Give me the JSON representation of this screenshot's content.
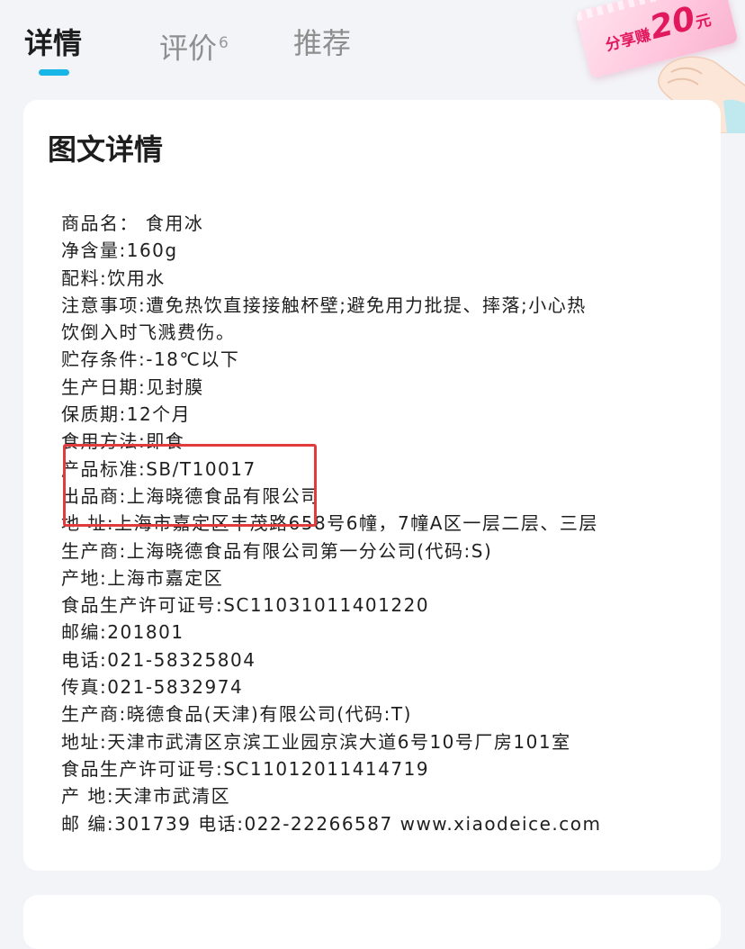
{
  "tabs": {
    "details": "详情",
    "reviews": "评价",
    "reviews_count": "6",
    "recommend": "推荐",
    "active": "details",
    "indicator_color": "#18b6e6"
  },
  "promo": {
    "prefix": "分享赚",
    "amount": "20",
    "unit": "元",
    "color": "#e2185c"
  },
  "section": {
    "title": "图文详情"
  },
  "details": [
    "商品名： 食用冰",
    "净含量:160g",
    "配料:饮用水",
    "注意事项:遭免热饮直接接触杯壁;避免用力批提、摔落;小心热",
    "饮倒入时飞溅费伤。",
    "贮存条件:-18℃以下",
    "生产日期:见封膜",
    "保质期:12个月",
    "食用方法:即食",
    "产品标准:SB/T10017",
    "出品商:上海晓德食品有限公司",
    "地 址:上海市嘉定区丰茂路658号6幢，7幢A区一层二层、三层",
    "生产商:上海晓德食品有限公司第一分公司(代码:S)",
    "产地:上海市嘉定区",
    "食品生产许可证号:SC11031011401220",
    "邮编:201801",
    "电话:021-58325804",
    "传真:021-5832974",
    "生产商:晓德食品(天津)有限公司(代码:T)",
    "地址:天津市武清区京滨工业园京滨大道6号10号厂房101室",
    "食品生产许可证号:SC11012011414719",
    "产 地:天津市武清区",
    "邮 编:301739 电话:022-22266587 www.xiaodeice.com"
  ],
  "highlight": {
    "color": "#e23b3b"
  }
}
